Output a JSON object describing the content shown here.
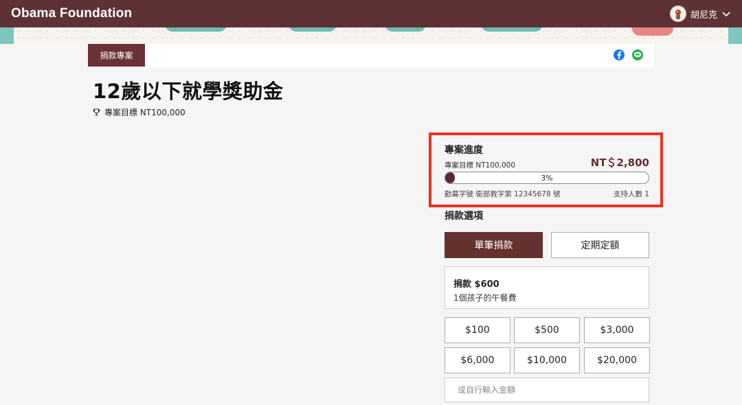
{
  "header": {
    "brand": "Obama Foundation",
    "user_name": "胡尼克"
  },
  "project": {
    "tag": "捐款專案",
    "title": "12歲以下就學獎助金",
    "goal_label": "專案目標 NT100,000"
  },
  "progress": {
    "title": "專案進度",
    "goal_label": "專案目標 NT100,000",
    "amount": "NT＄2,800",
    "percent_label": "3%",
    "percent_value": 0.03,
    "permit": "勸募字號 衛部救字第 12345678 號",
    "supporters": "支持人數 1"
  },
  "options": {
    "title": "捐款選項",
    "tab_single": "單筆捐款",
    "tab_regular": "定期定額",
    "selected": {
      "amount": "捐款 $600",
      "description": "1個孩子的午餐費"
    },
    "amounts": [
      "$100",
      "$500",
      "$3,000",
      "$6,000",
      "$10,000",
      "$20,000"
    ],
    "custom_placeholder": "或自行輸入金額"
  },
  "colors": {
    "brand": "#5e3235",
    "accent": "#64312f",
    "highlight": "#e8321f"
  },
  "icons": {
    "trophy": "trophy-icon",
    "facebook": "facebook-icon",
    "line": "line-icon",
    "chevron": "chevron-down-icon"
  }
}
